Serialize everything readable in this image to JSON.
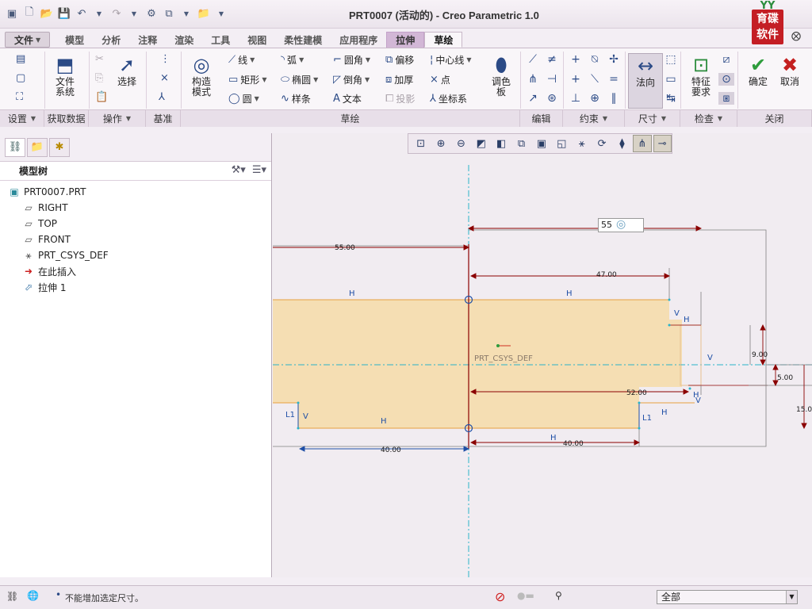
{
  "window": {
    "title": "PRT0007 (活动的) - Creo Parametric 1.0"
  },
  "logo": {
    "text_top": "育碟",
    "text_bottom": "软件",
    "mark": "YY"
  },
  "tabs": [
    {
      "label": "文件",
      "kind": "file"
    },
    {
      "label": "模型"
    },
    {
      "label": "分析"
    },
    {
      "label": "注释"
    },
    {
      "label": "渲染"
    },
    {
      "label": "工具"
    },
    {
      "label": "视图"
    },
    {
      "label": "柔性建模"
    },
    {
      "label": "应用程序"
    },
    {
      "label": "拉伸",
      "kind": "ctx"
    },
    {
      "label": "草绘",
      "kind": "active"
    }
  ],
  "ribbon": {
    "file_system": "文件\n系统",
    "select": "选择",
    "construction": "构造\n模式",
    "line": "线",
    "rectangle": "矩形",
    "circle": "圆",
    "arc": "弧",
    "ellipse": "椭圆",
    "spline": "样条",
    "fillet": "圆角",
    "chamfer": "倒角",
    "text": "文本",
    "offset": "偏移",
    "thicken": "加厚",
    "project": "投影",
    "centerline": "中心线",
    "point": "点",
    "coord_sys": "坐标系",
    "palette": "调色\n板",
    "normal": "法向",
    "feature_req": "特征\n要求",
    "ok": "确定",
    "cancel": "取消"
  },
  "groups": [
    {
      "label": "设置",
      "dd": true
    },
    {
      "label": "获取数据"
    },
    {
      "label": "操作",
      "dd": true
    },
    {
      "label": "基准"
    },
    {
      "label": "草绘"
    },
    {
      "label": "编辑"
    },
    {
      "label": "约束",
      "dd": true
    },
    {
      "label": "尺寸",
      "dd": true
    },
    {
      "label": "检查",
      "dd": true
    },
    {
      "label": "关闭"
    }
  ],
  "model_tree": {
    "header": "模型树",
    "nodes": [
      {
        "label": "PRT0007.PRT",
        "icon": "part-icon",
        "level": 0
      },
      {
        "label": "RIGHT",
        "icon": "datum-plane-icon",
        "level": 1
      },
      {
        "label": "TOP",
        "icon": "datum-plane-icon",
        "level": 1
      },
      {
        "label": "FRONT",
        "icon": "datum-plane-icon",
        "level": 1
      },
      {
        "label": "PRT_CSYS_DEF",
        "icon": "csys-icon",
        "level": 1
      },
      {
        "label": "在此插入",
        "icon": "insert-arrow-icon",
        "level": 1
      },
      {
        "label": "拉伸 1",
        "icon": "extrude-icon",
        "level": 1
      }
    ]
  },
  "sketch": {
    "dim_input_value": "55",
    "csys_label": "PRT_CSYS_DEF",
    "dimensions": [
      "55.00",
      "47.00",
      "9.00",
      "5.00",
      "52.00",
      "15.0",
      "40.00",
      "40.00"
    ],
    "constraint_H": "H",
    "constraint_V": "V",
    "constraint_L1": "L1"
  },
  "status": {
    "message": "不能增加选定尺寸。",
    "filter_value": "全部"
  },
  "colors": {
    "fill": "#f5deb3",
    "dim": "#8b0000",
    "sketch_blue": "#1f4fa6",
    "centerline": "#2ab3c9"
  }
}
